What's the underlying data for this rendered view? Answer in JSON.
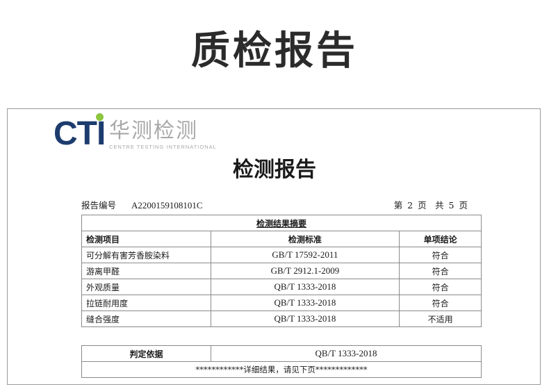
{
  "page_heading": "质检报告",
  "logo": {
    "brand": "CTI",
    "chinese_name": "华测检测",
    "english_name": "CENTRE TESTING INTERNATIONAL"
  },
  "report": {
    "title": "检测报告",
    "number_label": "报告编号",
    "number_value": "A2200159108101C",
    "page_info": "第 2 页　共 5 页"
  },
  "summary": {
    "caption": "检测结果摘要",
    "headers": [
      "检测项目",
      "检测标准",
      "单项结论"
    ],
    "rows": [
      {
        "item": "可分解有害芳香胺染料",
        "standard": "GB/T 17592-2011",
        "result": "符合"
      },
      {
        "item": "游离甲醛",
        "standard": "GB/T 2912.1-2009",
        "result": "符合"
      },
      {
        "item": "外观质量",
        "standard": "QB/T 1333-2018",
        "result": "符合"
      },
      {
        "item": "拉链耐用度",
        "standard": "QB/T 1333-2018",
        "result": "符合"
      },
      {
        "item": "缝合强度",
        "standard": "QB/T 1333-2018",
        "result": "不适用"
      }
    ]
  },
  "basis": {
    "label": "判定依据",
    "value": "QB/T 1333-2018",
    "note": "************详细结果，请见下页*************"
  },
  "colors": {
    "logo_blue": "#1d3c6e",
    "logo_green": "#8cc63f",
    "logo_gray": "#a8a8a8"
  }
}
